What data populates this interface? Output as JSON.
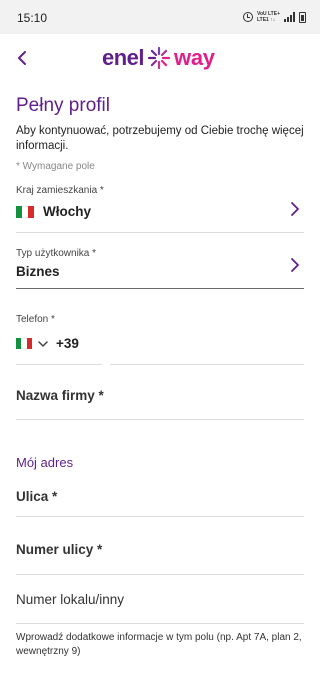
{
  "status_bar": {
    "time": "15:10",
    "network_line1": "VoU LTE+",
    "network_line2": "LTE1 ↑↓",
    "icons": [
      "alarm-icon",
      "signal-icon",
      "battery-icon"
    ]
  },
  "app_bar": {
    "back_icon": "chevron-left-icon",
    "logo_enel": "enel",
    "logo_way": "way",
    "colors": {
      "brand_purple": "#5f1f8c",
      "brand_pink": "#e01e8c"
    }
  },
  "form": {
    "title": "Pełny profil",
    "intro": "Aby kontynuować, potrzebujemy od Ciebie trochę więcej informacji.",
    "required_note": "* Wymagane pole",
    "country": {
      "label": "Kraj zamieszkania *",
      "value": "Włochy",
      "flag": "italy-flag-icon"
    },
    "user_type": {
      "label": "Typ użytkownika *",
      "value": "Biznes"
    },
    "phone": {
      "label": "Telefon *",
      "flag": "italy-flag-icon",
      "code": "+39"
    },
    "company": {
      "placeholder": "Nazwa firmy *"
    },
    "address_section": "Mój adres",
    "street": {
      "placeholder": "Ulica *"
    },
    "street_number": {
      "placeholder": "Numer ulicy *"
    },
    "unit_number": {
      "placeholder": "Numer lokalu/inny"
    },
    "unit_helper": "Wprowadź dodatkowe informacje w tym polu (np. Apt 7A, plan 2, wewnętrzny 9)"
  }
}
